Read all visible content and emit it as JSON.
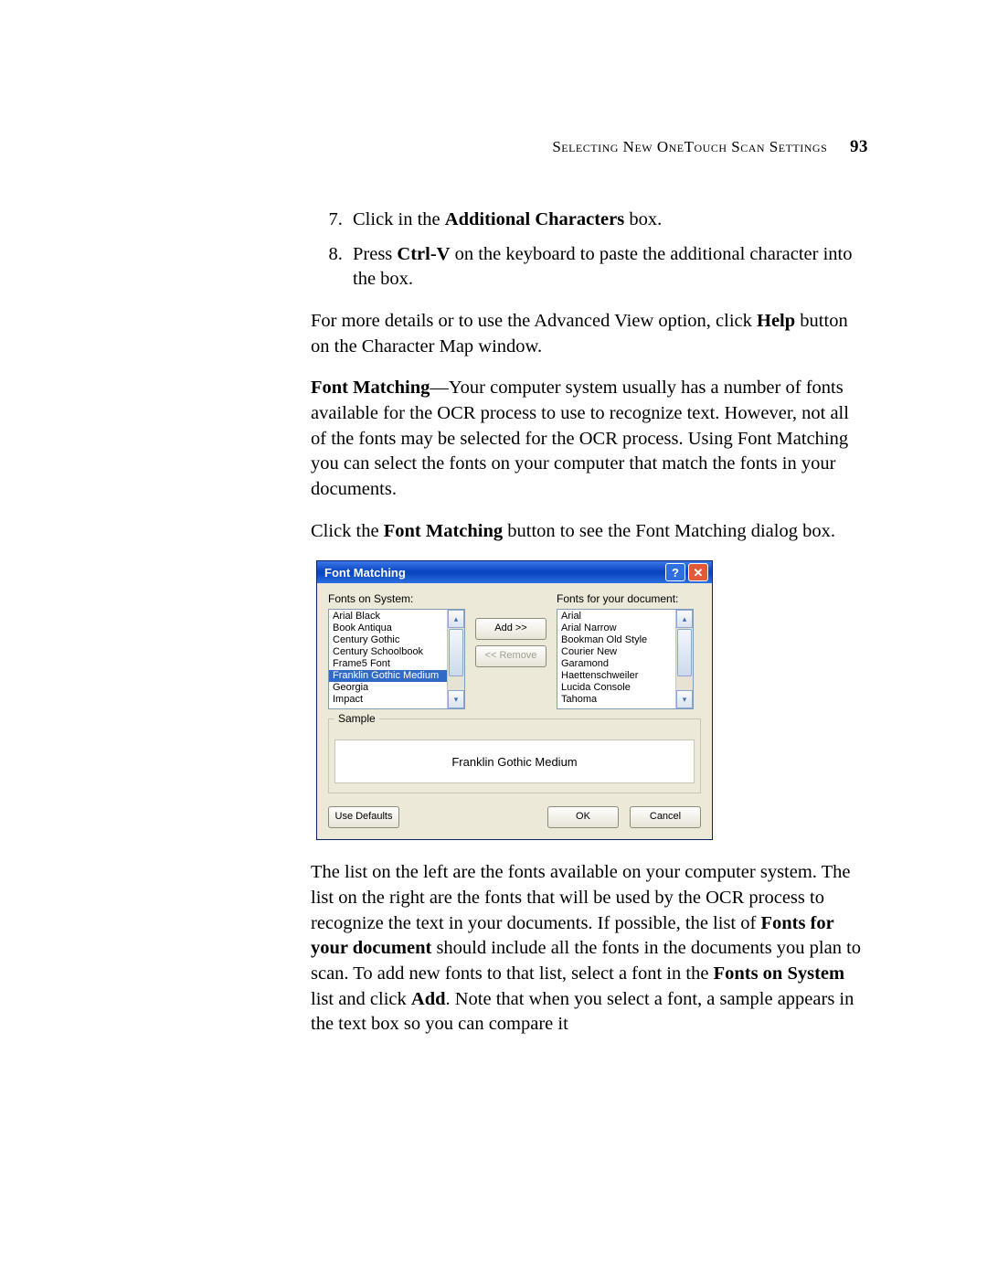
{
  "header": {
    "section_title": "Selecting New OneTouch Scan Settings",
    "page_number": "93"
  },
  "step7": {
    "prefix": "Click in the ",
    "bold": "Additional Characters",
    "suffix": " box."
  },
  "step8": {
    "prefix": "Press ",
    "bold": "Ctrl-V",
    "suffix": " on the keyboard to paste the additional character into the box."
  },
  "p_help": {
    "pre": "For more details or to use the Advanced View option, click ",
    "bold": "Help",
    "post": " button on the Character Map window."
  },
  "p_fontmatch": {
    "bold": "Font Matching",
    "rest": "—Your computer system usually has a number of fonts available for the OCR process to use to recognize text. However, not all of the fonts may be selected for the OCR process. Using Font Matching you can select the fonts on your computer that match the fonts in your documents."
  },
  "p_clickfm": {
    "pre": "Click the ",
    "bold": "Font Matching",
    "post": " button to see the Font Matching dialog box."
  },
  "dialog": {
    "title": "Font Matching",
    "help_glyph": "?",
    "close_glyph": "✕",
    "label_left": "Fonts on System:",
    "label_right": "Fonts for your document:",
    "fonts_system": [
      "Arial Black",
      "Book Antiqua",
      "Century Gothic",
      "Century Schoolbook",
      "Frame5 Font",
      "Franklin Gothic Medium",
      "Georgia",
      "Impact"
    ],
    "selected_left_index": 5,
    "fonts_document": [
      "Arial",
      "Arial Narrow",
      "Bookman Old Style",
      "Courier New",
      "Garamond",
      "Haettenschweiler",
      "Lucida Console",
      "Tahoma"
    ],
    "add_label": "Add >>",
    "remove_label": "<< Remove",
    "sample_legend": "Sample",
    "sample_text": "Franklin Gothic Medium",
    "use_defaults": "Use Defaults",
    "ok": "OK",
    "cancel": "Cancel",
    "up_glyph": "▴",
    "down_glyph": "▾"
  },
  "p_after": {
    "t1": "The list on the left are the fonts available on your computer system. The list on the right are the fonts that will be used by the OCR process to recognize the text in your documents. If possible, the list of ",
    "b1": "Fonts for your document",
    "t2": " should include all the fonts in the documents you plan to scan. To add new fonts to that list, select a font in the ",
    "b2": "Fonts on System",
    "t3": " list and click ",
    "b3": "Add",
    "t4": ". Note that when you select a font, a sample appears in the text box so you can compare it"
  }
}
